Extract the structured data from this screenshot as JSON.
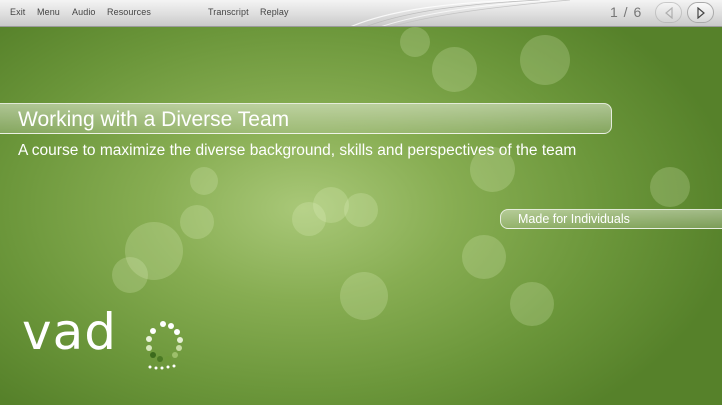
{
  "toolbar": {
    "items": [
      {
        "label": "Exit"
      },
      {
        "label": "Menu"
      },
      {
        "label": "Audio"
      },
      {
        "label": "Resources"
      },
      {
        "label": "Transcript"
      },
      {
        "label": "Replay"
      }
    ],
    "page_counter": "1 / 6",
    "prev_icon": "triangle-left-icon",
    "next_icon": "triangle-right-icon"
  },
  "slide": {
    "title": "Working with a Diverse Team",
    "subtitle": "A course to maximize the diverse background, skills and perspectives of the team",
    "audience": "Made for Individuals"
  },
  "logo": {
    "text": "vad"
  },
  "colors": {
    "background_green": "#7aa444",
    "toolbar_gray": "#dcdcdc",
    "text_white": "#ffffff"
  }
}
